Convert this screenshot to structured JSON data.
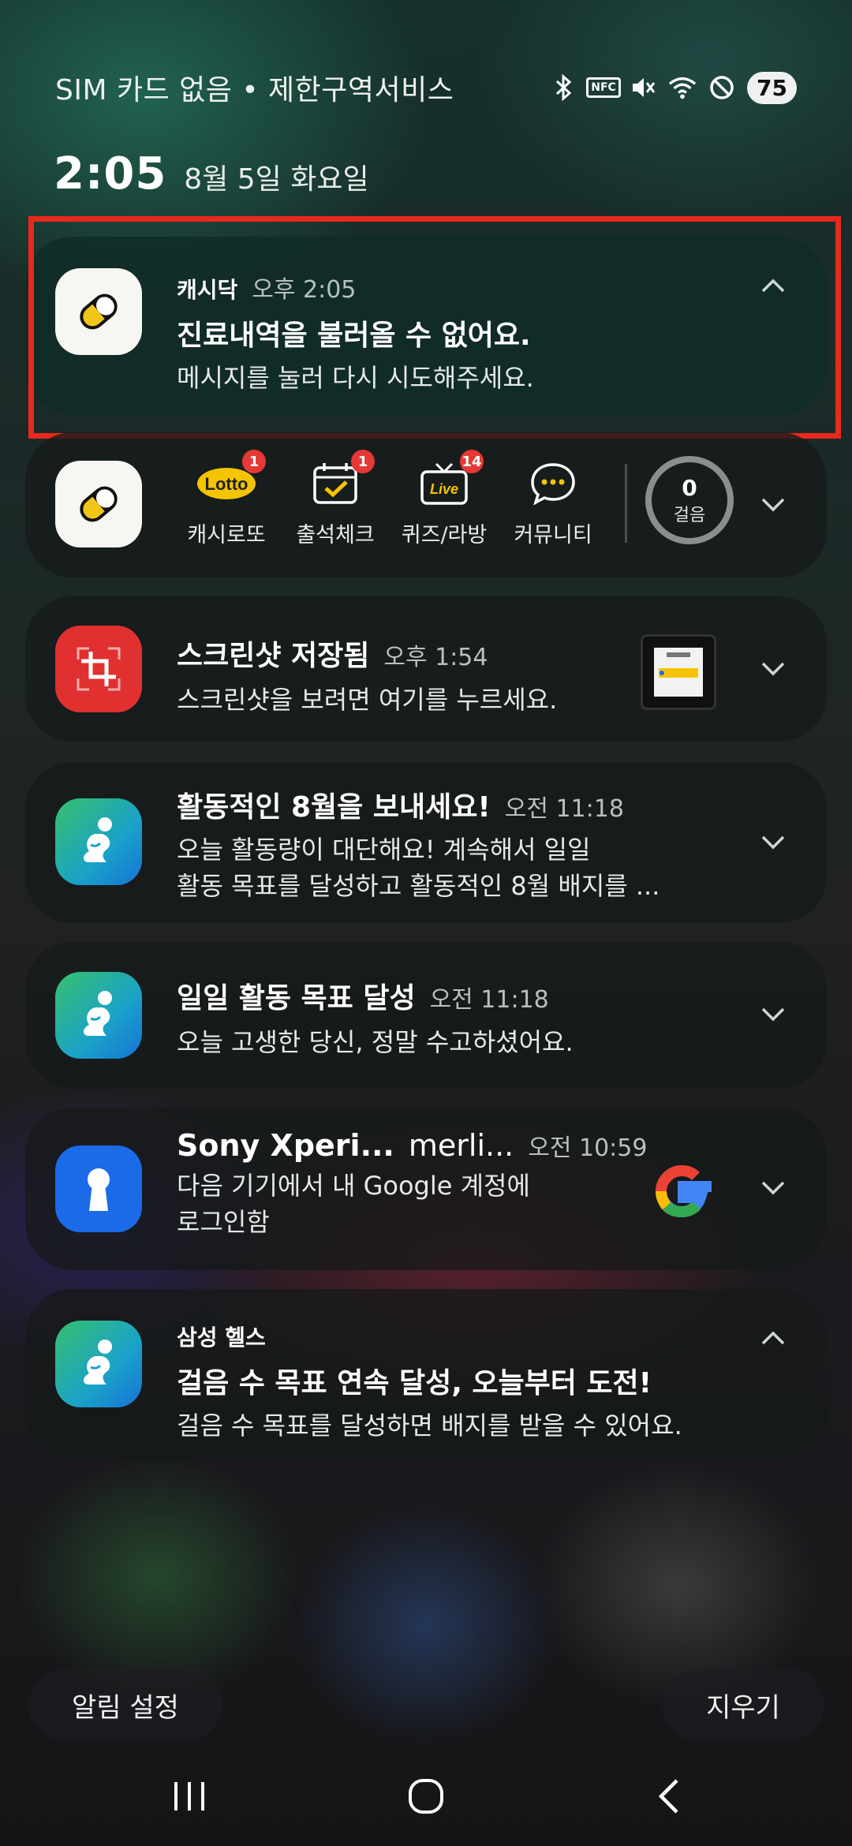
{
  "status_bar": {
    "carrier_text": "SIM 카드 없음 • 제한구역서비스",
    "nfc_label": "NFC",
    "battery_level": "75",
    "icons": [
      "bluetooth-icon",
      "nfc-icon",
      "mute-icon",
      "wifi-icon",
      "do-not-disturb-icon",
      "battery-icon"
    ]
  },
  "clock": {
    "time": "2:05",
    "date": "8월 5일 화요일"
  },
  "notifications": [
    {
      "app": "캐시닥",
      "time": "오후 2:05",
      "title": "진료내역을 불러올 수 없어요.",
      "body": "메시지를 눌러 다시 시도해주세요.",
      "icon": "cashdoc-pill-icon",
      "expanded": true
    },
    {
      "app_icon": "cashdoc-pill-icon",
      "quick_actions": [
        {
          "label": "캐시로또",
          "badge": "1",
          "icon": "lotto-icon",
          "icon_text": "Lotto"
        },
        {
          "label": "출석체크",
          "badge": "1",
          "icon": "calendar-check-icon"
        },
        {
          "label": "퀴즈/라방",
          "badge": "14",
          "icon": "live-tv-icon",
          "icon_text": "Live"
        },
        {
          "label": "커뮤니티",
          "badge": "",
          "icon": "chat-bubble-icon"
        }
      ],
      "steps": {
        "count": "0",
        "label": "걸음"
      }
    },
    {
      "title": "스크린샷 저장됨",
      "time": "오후 1:54",
      "body": "스크린샷을 보려면 여기를 누르세요.",
      "icon": "screenshot-icon"
    },
    {
      "title": "활동적인 8월을 보내세요!",
      "time": "오전 11:18",
      "body_line1": "오늘 활동량이 대단해요! 계속해서 일일",
      "body_line2": "활동 목표를 달성하고 활동적인 8월 배지를 ...",
      "icon": "samsung-health-icon"
    },
    {
      "title": "일일 활동 목표 달성",
      "time": "오전 11:18",
      "body": "오늘 고생한 당신, 정말 수고하셨어요.",
      "icon": "samsung-health-icon"
    },
    {
      "title": "Sony Xperi...",
      "subtitle": "merli...",
      "time": "오전 10:59",
      "body_line1": "다음 기기에서 내 Google 계정에",
      "body_line2": "로그인함",
      "icon": "keyhole-icon"
    },
    {
      "app": "삼성 헬스",
      "title": "걸음 수 목표 연속 달성, 오늘부터 도전!",
      "body": "걸음 수 목표를 달성하면 배지를 받을 수 있어요.",
      "icon": "samsung-health-icon",
      "expanded": true
    }
  ],
  "footer": {
    "settings_label": "알림 설정",
    "clear_label": "지우기"
  },
  "colors": {
    "highlight_border": "#e8291c",
    "badge": "#e53935"
  }
}
